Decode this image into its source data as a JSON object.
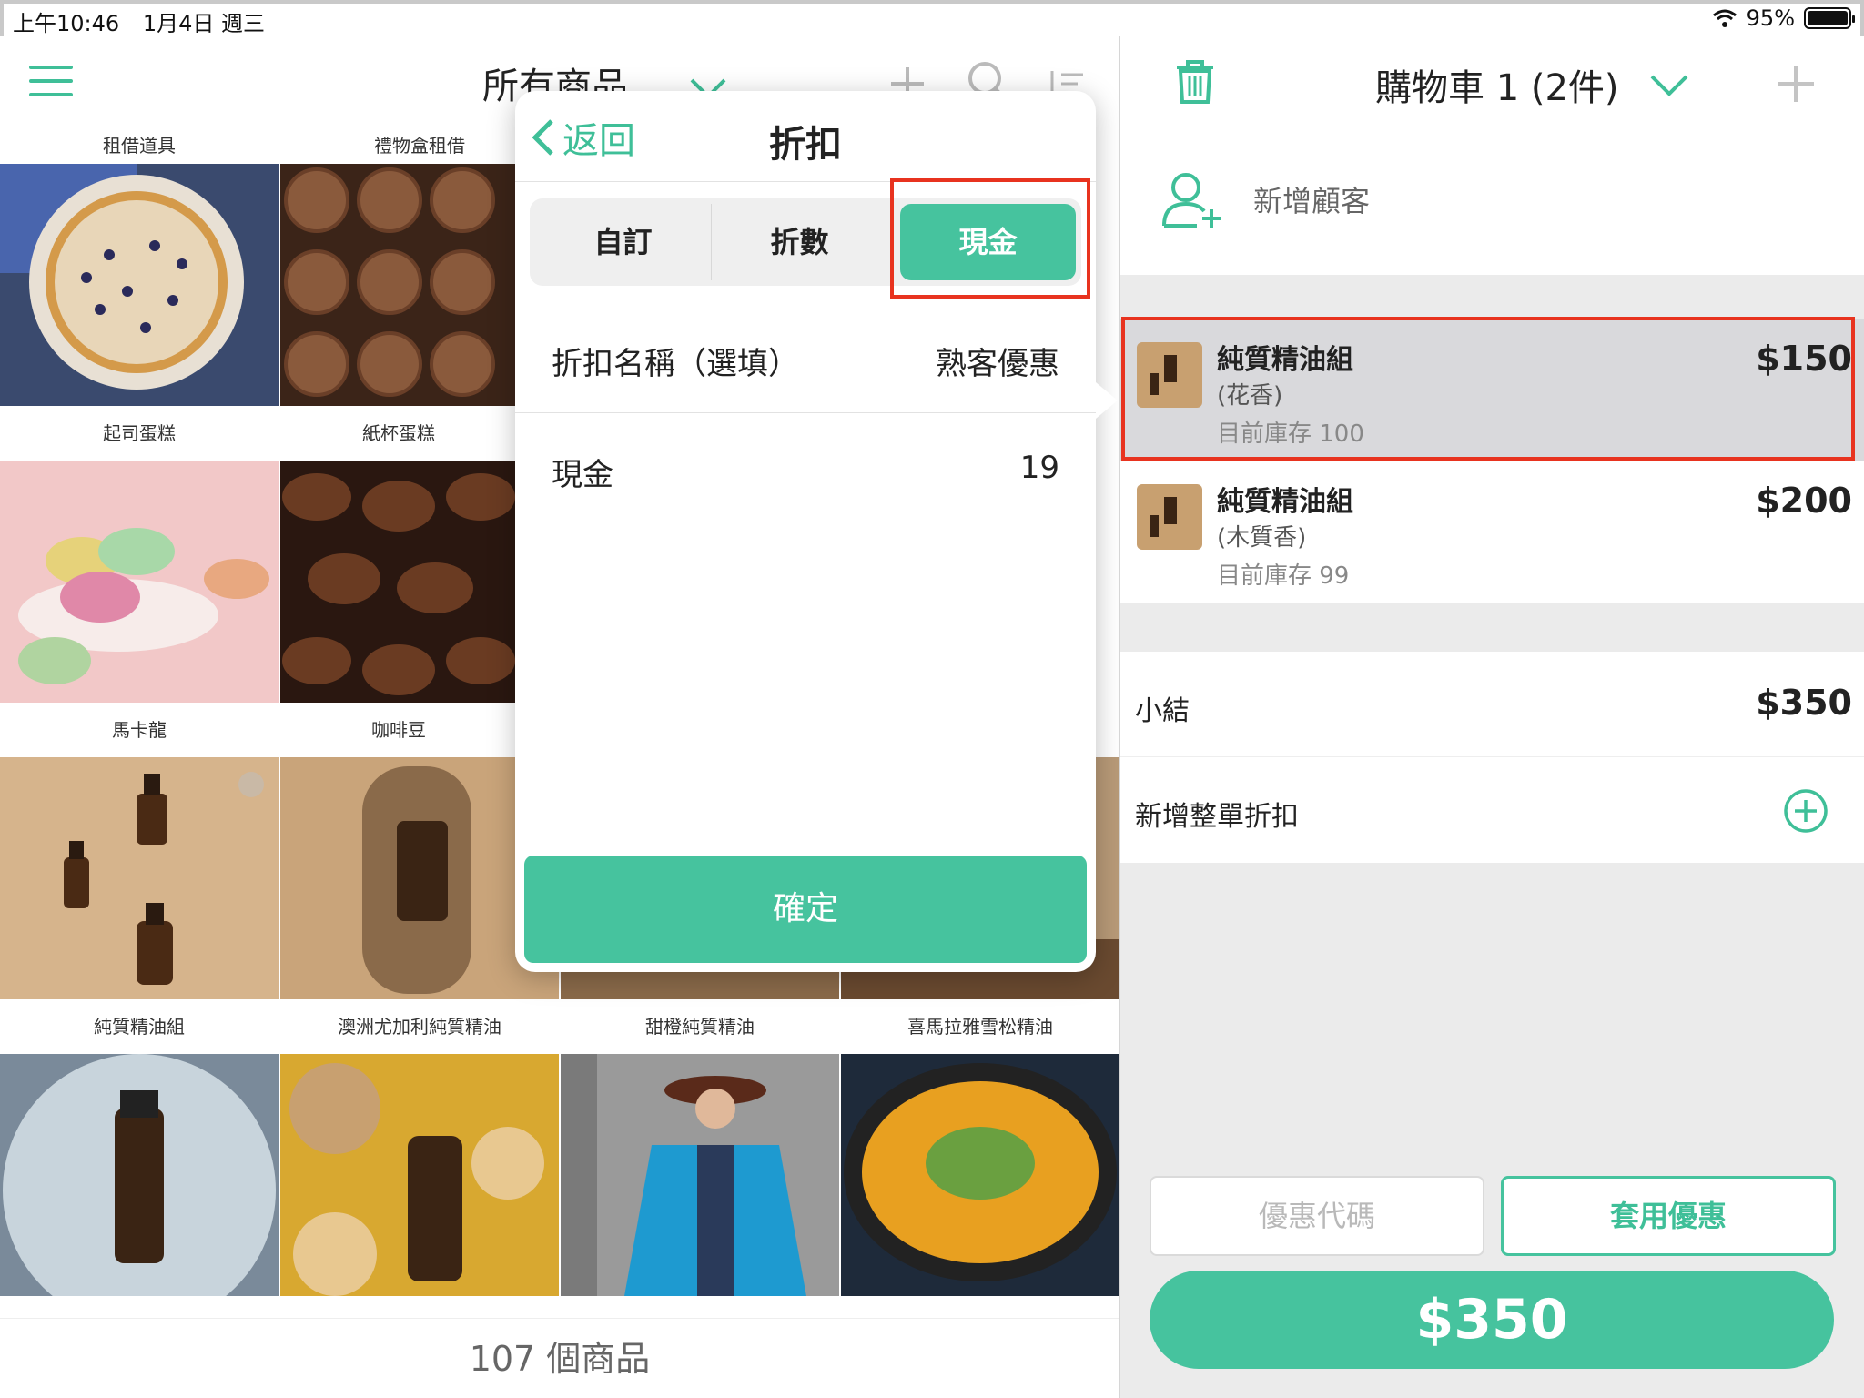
{
  "status_bar": {
    "time": "上午10:46",
    "date": "1月4日 週三",
    "battery": "95%"
  },
  "left_panel": {
    "title": "所有商品",
    "count": "107 個商品",
    "top_labels": [
      "租借道具",
      "禮物盒租借"
    ],
    "rows": [
      {
        "labels": [
          "起司蛋糕",
          "紙杯蛋糕"
        ]
      },
      {
        "labels": [
          "馬卡龍",
          "咖啡豆"
        ]
      },
      {
        "labels": [
          "純質精油組",
          "澳洲尤加利純質精油",
          "甜橙純質精油",
          "喜馬拉雅雪松精油"
        ]
      }
    ]
  },
  "popover": {
    "back_label": "返回",
    "title": "折扣",
    "segments": [
      "自訂",
      "折數",
      "現金"
    ],
    "active_segment": "現金",
    "name_label": "折扣名稱（選填）",
    "name_value": "熟客優惠",
    "cash_label": "現金",
    "cash_value": "19",
    "confirm_label": "確定"
  },
  "cart": {
    "title": "購物車 1 (2件)",
    "add_customer": "新增顧客",
    "items": [
      {
        "name": "純質精油組",
        "variant": "(花香)",
        "stock": "目前庫存 100",
        "price": "$150"
      },
      {
        "name": "純質精油組",
        "variant": "(木質香)",
        "stock": "目前庫存 99",
        "price": "$200"
      }
    ],
    "subtotal_label": "小結",
    "subtotal_value": "$350",
    "order_discount_label": "新增整單折扣",
    "coupon_placeholder": "優惠代碼",
    "apply_coupon_label": "套用優惠",
    "total_button": "$350"
  },
  "colors": {
    "accent": "#46c39e",
    "highlight": "#e8331f"
  }
}
